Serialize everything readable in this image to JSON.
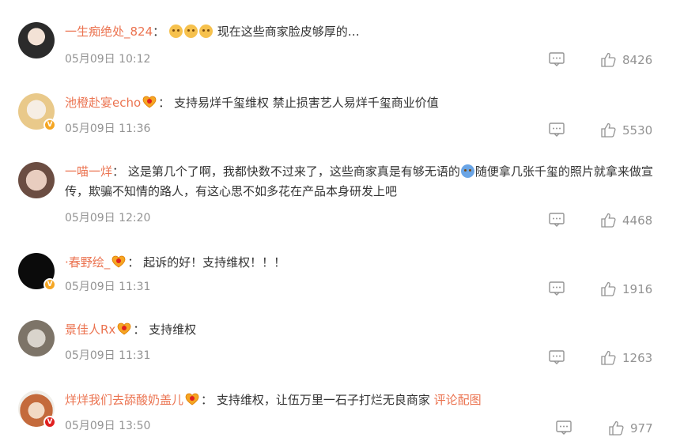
{
  "comments": [
    {
      "username": "一生痴绝处_824",
      "colon": "：",
      "text": "现在这些商家脸皮够厚的…",
      "emojis": [
        "yellow",
        "yellow",
        "yellow"
      ],
      "date": "05月09日 10:12",
      "likes": "8426",
      "avatar_badge": "none",
      "fan_icon": false
    },
    {
      "username": "池橙赴宴echo",
      "colon": "：",
      "text": "支持易烊千玺维权 禁止损害艺人易烊千玺商业价值",
      "date": "05月09日 11:36",
      "likes": "5530",
      "avatar_badge": "gold",
      "fan_icon": true
    },
    {
      "username": "一喵一烊",
      "colon": "：",
      "text_part1": "这是第几个了啊，我都快数不过来了，这些商家真是有够无语的",
      "text_part2": "随便拿几张千玺的照片就拿来做宣传，欺骗不知情的路人，有这心思不如多花在产品本身研发上吧",
      "date": "05月09日 12:20",
      "likes": "4468",
      "avatar_badge": "none",
      "fan_icon": false
    },
    {
      "username": "·春野绘_",
      "colon": "：",
      "text": "起诉的好！支持维权！！！",
      "date": "05月09日 11:31",
      "likes": "1916",
      "avatar_badge": "gold",
      "fan_icon": true
    },
    {
      "username": "景佳人Rx",
      "colon": "：",
      "text": "支持维权",
      "date": "05月09日 11:31",
      "likes": "1263",
      "avatar_badge": "none",
      "fan_icon": true
    },
    {
      "username": "烊烊我们去舔酸奶盖儿",
      "colon": "：",
      "text": "支持维权，让伍万里一石子打烂无良商家",
      "link": "评论配图",
      "date": "05月09日 13:50",
      "likes": "977",
      "avatar_badge": "red",
      "fan_icon": true
    }
  ],
  "badge_letter": "V",
  "colors": {
    "username": "#eb7350",
    "meta": "#939393",
    "text": "#333333"
  }
}
